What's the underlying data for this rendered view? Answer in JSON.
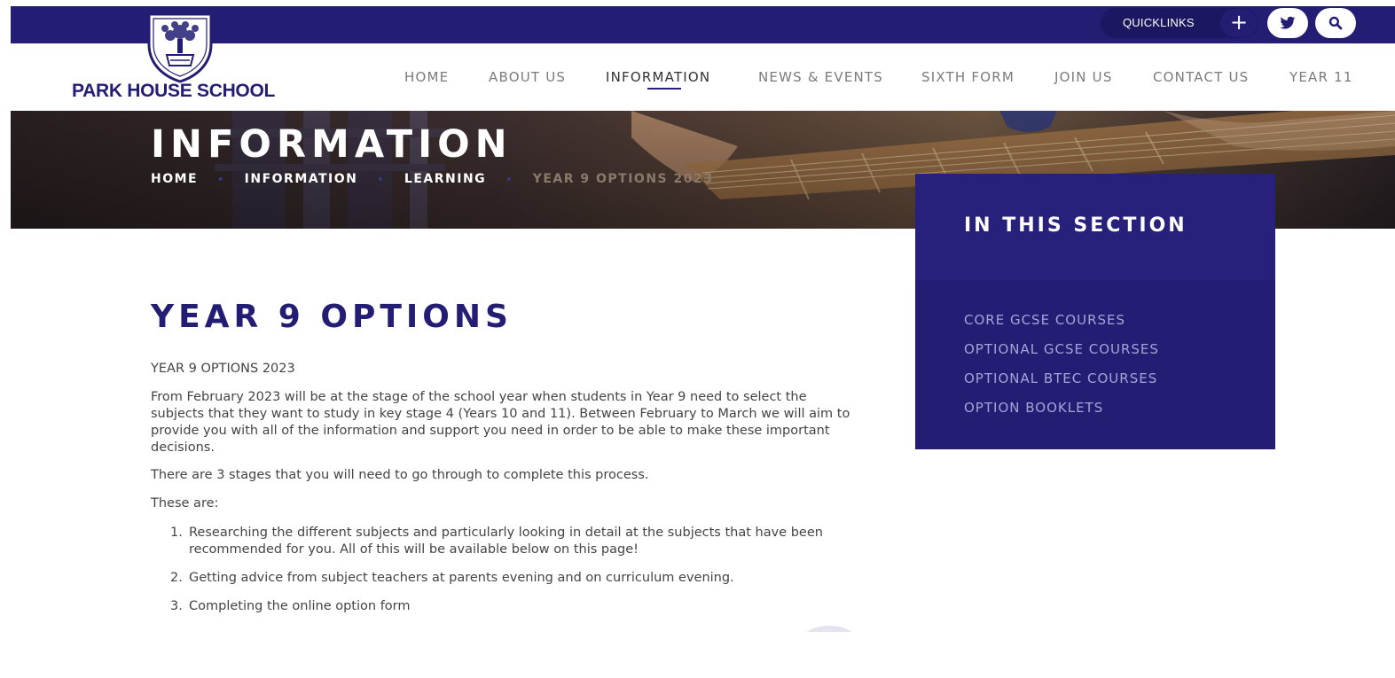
{
  "topbar": {
    "quicklinks_label": "QUICKLINKS",
    "plus_symbol": "+",
    "icons": [
      "twitter-icon",
      "search-icon"
    ]
  },
  "brand": {
    "school_name": "PARK HOUSE SCHOOL",
    "crest_icon": "school-crest-logo",
    "primary_color": "#231e74"
  },
  "nav": {
    "items": [
      {
        "label": "HOME"
      },
      {
        "label": "ABOUT US"
      },
      {
        "label": "INFORMATION"
      },
      {
        "label": "NEWS & EVENTS"
      },
      {
        "label": "SIXTH FORM"
      },
      {
        "label": "JOIN US"
      },
      {
        "label": "CONTACT US"
      },
      {
        "label": "YEAR 11"
      }
    ],
    "active": "INFORMATION"
  },
  "banner": {
    "title": "INFORMATION",
    "breadcrumbs": [
      "HOME",
      "INFORMATION",
      "LEARNING",
      "YEAR 9 OPTIONS 2023"
    ],
    "separator": "•"
  },
  "sidebar": {
    "title": "IN THIS SECTION",
    "links": [
      {
        "label": "CORE GCSE COURSES"
      },
      {
        "label": "OPTIONAL GCSE COURSES"
      },
      {
        "label": "OPTIONAL BTEC COURSES"
      },
      {
        "label": "OPTION BOOKLETS"
      }
    ]
  },
  "main": {
    "heading": "YEAR 9 OPTIONS",
    "subheading": "YEAR 9 OPTIONS 2023",
    "intro": "From February 2023 will be at the stage of the school year when students in Year 9 need to select the subjects that they want to study in key stage 4 (Years 10 and 11). Between February to March we will aim to provide you with all of the information and support you need in order to be able to make these important decisions.",
    "stages_text": "There are 3 stages that you will need to go through to complete this process.",
    "these_are": "These are:",
    "steps": [
      {
        "num": "1.",
        "text": "Researching  the different subjects and particularly looking in detail at the subjects that have been recommended for you. All of this will be available below on this page!"
      },
      {
        "num": "2.",
        "text": "Getting advice from subject teachers at parents evening and on curriculum evening."
      },
      {
        "num": "3.",
        "text": "Completing the online option form"
      }
    ]
  }
}
